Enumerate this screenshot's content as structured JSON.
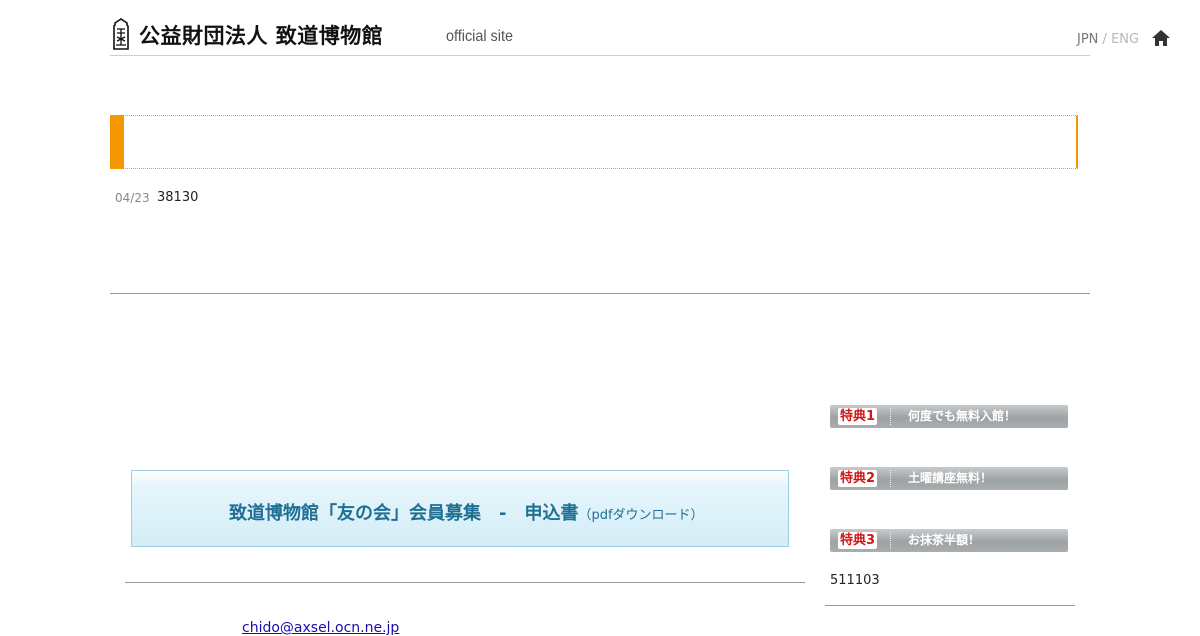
{
  "header": {
    "site_title": "公益財団法人 致道博物館",
    "site_subtitle": "official site",
    "lang_jpn": "JPN",
    "lang_sep": " / ",
    "lang_eng": "ENG",
    "home_icon": "home-icon",
    "logo_icon": "museum-crest-icon"
  },
  "news": {
    "date": "04/23",
    "count": "38130",
    "accent_color": "#f39800"
  },
  "benefits": [
    {
      "badge": "特典1",
      "label": "何度でも無料入館！"
    },
    {
      "badge": "特典2",
      "label": "土曜講座無料！"
    },
    {
      "badge": "特典3",
      "label": "お抹茶半額！"
    }
  ],
  "recruit": {
    "title": "致道博物館「友の会」会員募集　-　申込書",
    "note": "（pdfダウンロード）"
  },
  "right_count": "511103",
  "email": "chido@axsel.ocn.ne.jp"
}
